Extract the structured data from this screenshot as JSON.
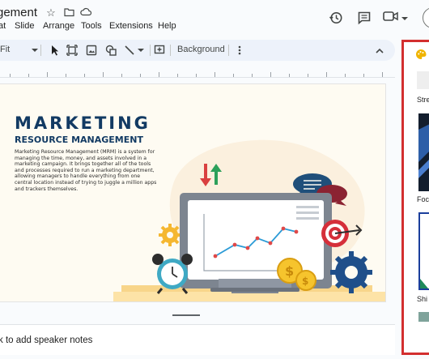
{
  "app": {
    "title": "gement",
    "menu": [
      "at",
      "Slide",
      "Arrange",
      "Tools",
      "Extensions",
      "Help"
    ]
  },
  "toolbar": {
    "zoom_label": "Fit",
    "background_label": "Background"
  },
  "slide": {
    "title": "MARKETING",
    "subtitle": "RESOURCE MANAGEMENT",
    "body": "Marketing Resource Management (MRM) is a system for managing the time, money, and assets involved in a marketing campaign. It brings together all of the tools and processes required to run a marketing department, allowing managers to handle everything from one central location instead of trying to juggle a million apps and trackers themselves."
  },
  "notes": {
    "placeholder": "k to add speaker notes"
  },
  "themes_panel": {
    "items": [
      "Stre",
      "Foc",
      "Shi"
    ]
  },
  "colors": {
    "accent_red": "#d32f2f",
    "slide_title": "#123a63",
    "toolbar_bg": "#edf2fa"
  }
}
